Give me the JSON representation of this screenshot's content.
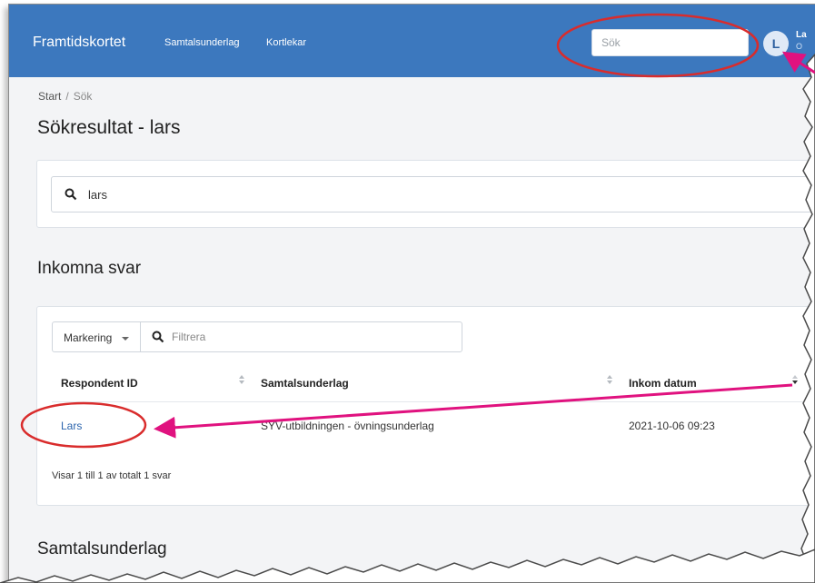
{
  "navbar": {
    "brand": "Framtidskortet",
    "links": [
      "Samtalsunderlag",
      "Kortlekar"
    ],
    "search_placeholder": "Sök",
    "avatar_letter": "L",
    "user_name": "La",
    "user_sub": "O",
    "color": "#3c78be"
  },
  "breadcrumb": {
    "home": "Start",
    "separator": "/",
    "current": "Sök"
  },
  "page_title": "Sökresultat - lars",
  "search": {
    "value": "lars",
    "icon": "search-icon"
  },
  "inkomna": {
    "title": "Inkomna svar",
    "marking_label": "Markering",
    "filter_placeholder": "Filtrera",
    "columns": [
      "Respondent ID",
      "Samtalsunderlag",
      "Inkom datum"
    ],
    "rows": [
      {
        "respondent": "Lars",
        "underlag": "SYV-utbildningen - övningsunderlag",
        "date": "2021-10-06 09:23"
      }
    ],
    "summary": "Visar 1 till 1 av totalt 1 svar"
  },
  "samtalsunderlag": {
    "title": "Samtalsunderlag"
  },
  "annotations": {
    "ellipse_color": "#d92c2c",
    "arrow_color": "#e0127f"
  }
}
